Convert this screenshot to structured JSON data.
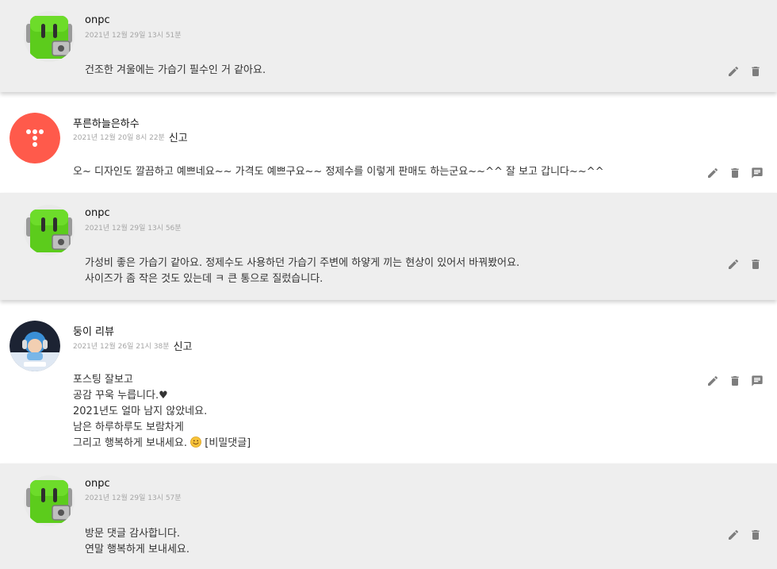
{
  "comments": [
    {
      "kind": "reply",
      "author": "onpc",
      "date": "2021년 12월 29일 13시 51분",
      "lines": [
        "건조한 겨울에는 가습기 필수인 거 같아요."
      ]
    },
    {
      "kind": "main",
      "author": "푸른하늘은하수",
      "date": "2021년 12월 20일 8시 22분",
      "report": "신고",
      "lines": [
        "오~ 디자인도 깔끔하고 예쁘네요~~ 가격도 예쁘구요~~ 정제수를 이렇게 판매도 하는군요~~^^ 잘 보고 갑니다~~^^"
      ]
    },
    {
      "kind": "reply",
      "author": "onpc",
      "date": "2021년 12월 29일 13시 56분",
      "lines": [
        "가성비 좋은 가습기 같아요. 정제수도 사용하던 가습기 주변에 하얗게 끼는 현상이 있어서 바꿔봤어요.",
        "사이즈가 좀 작은 것도 있는데 ㅋ 큰 통으로 질렀습니다."
      ]
    },
    {
      "kind": "main",
      "author": "둥이 리뷰",
      "date": "2021년 12월 26일 21시 38분",
      "report": "신고",
      "lines": [
        "포스팅 잘보고",
        "공감 꾸욱 누릅니다.♥",
        "2021년도 얼마 남지 않았네요.",
        "남은 하루하루도 보람차게",
        "그리고 행복하게 보내세요."
      ],
      "secret_tag": "[비밀댓글]"
    },
    {
      "kind": "reply",
      "author": "onpc",
      "date": "2021년 12월 29일 13시 57분",
      "lines": [
        "방문 댓글 감사합니다.",
        "연말 행복하게 보내세요."
      ]
    }
  ],
  "icons": {
    "edit": "pencil-icon",
    "delete": "trash-icon",
    "reply": "comment-icon"
  },
  "colors": {
    "reply_bg": "#eeeeee",
    "icon": "#7d7d7d",
    "date": "#a5a5a5",
    "avatar_green": "#5ccc1c",
    "avatar_red": "#ff5a4b"
  }
}
